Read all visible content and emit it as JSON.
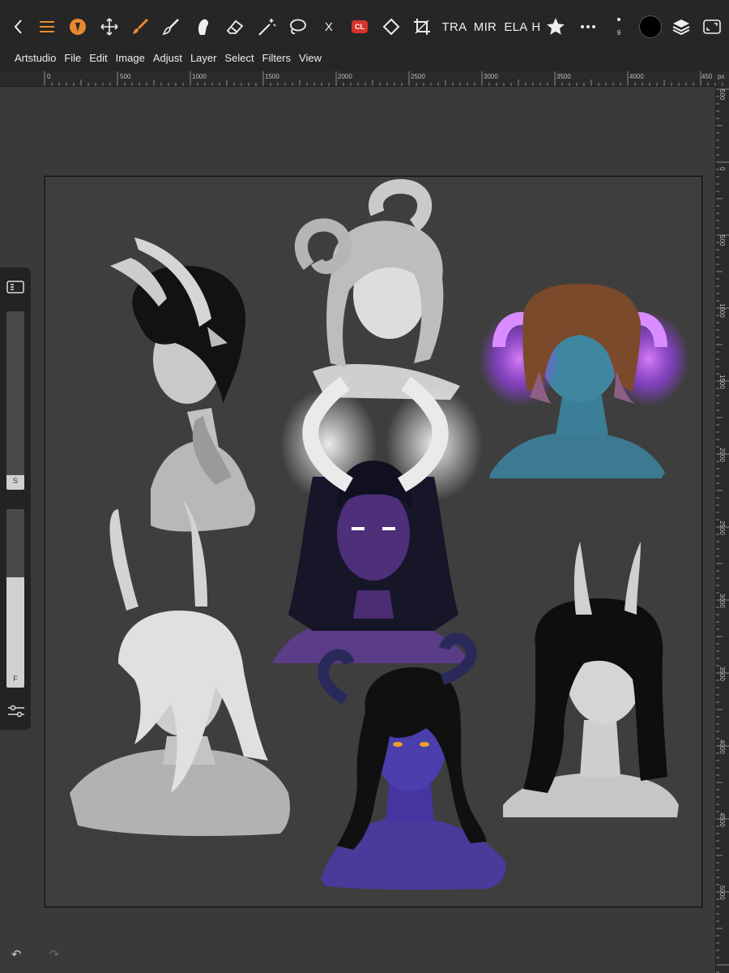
{
  "toolbar": {
    "back_icon": "chevron-left-icon",
    "items": [
      {
        "name": "menu-button",
        "icon": "hamburger-icon"
      },
      {
        "name": "brush-mode-button",
        "icon": "brush-tip-icon"
      },
      {
        "name": "move-tool-button",
        "icon": "move-icon"
      },
      {
        "name": "brush-tool-button",
        "icon": "paintbrush-icon"
      },
      {
        "name": "smudge-tool-button",
        "icon": "smudge-icon"
      },
      {
        "name": "blend-tool-button",
        "icon": "blend-icon"
      },
      {
        "name": "eraser-tool-button",
        "icon": "eraser-icon"
      },
      {
        "name": "magic-wand-button",
        "icon": "magic-wand-icon"
      },
      {
        "name": "lasso-tool-button",
        "icon": "lasso-icon"
      }
    ],
    "text_tools": {
      "x": "X",
      "cl": "CL",
      "tra": "TRA",
      "mir": "MIR",
      "ela": "ELA",
      "h": "H"
    },
    "brush_size": "9",
    "accent_color": "#e8892f",
    "current_color": "#000000"
  },
  "menubar": [
    "Artstudio",
    "File",
    "Edit",
    "Image",
    "Adjust",
    "Layer",
    "Select",
    "Filters",
    "View"
  ],
  "ruler": {
    "top_labels": [
      "0",
      "500",
      "1000",
      "1500",
      "2000",
      "2500",
      "3000",
      "3500",
      "4000",
      "450"
    ],
    "unit": "px",
    "right_labels": [
      "500",
      "0",
      "500",
      "1000",
      "1500",
      "2000",
      "2500",
      "3000",
      "3500",
      "4000",
      "4500",
      "5000"
    ]
  },
  "side_panel": {
    "size_label": "S",
    "flow_label": "F",
    "size_value_pct": 8,
    "flow_value_pct": 62
  },
  "bottom": {
    "undo": "↶",
    "redo": "↷"
  },
  "artwork": {
    "colors": {
      "gray": "#c8c8c8",
      "blue_skin": "#3a7e98",
      "purple_skin": "#4e2f7a",
      "indigo_skin": "#4a3a9a",
      "glow": "#c060ff"
    }
  }
}
